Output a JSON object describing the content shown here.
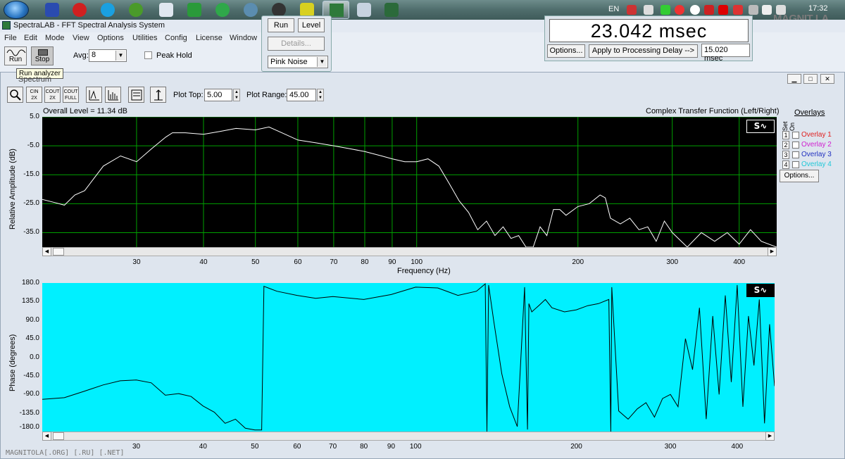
{
  "taskbar": {
    "language": "EN",
    "clock": "17:32",
    "tray_logo": "MAGNIT LA"
  },
  "window": {
    "title": "SpectraLAB - FFT Spectral Analysis System"
  },
  "menu": [
    "File",
    "Edit",
    "Mode",
    "View",
    "Options",
    "Utilities",
    "Config",
    "License",
    "Window"
  ],
  "toolbar": {
    "run_label": "Run",
    "stop_label": "Stop",
    "avg_label": "Avg:",
    "avg_value": "8",
    "peak_hold_label": "Peak Hold",
    "tooltip": "Run analyzer"
  },
  "generator": {
    "run_label": "Run",
    "level_label": "Level",
    "details_label": "Details...",
    "noise_value": "Pink Noise"
  },
  "delay": {
    "display": "23.042 msec",
    "options_label": "Options...",
    "apply_label": "Apply to Processing Delay -->",
    "value": "15.020 msec"
  },
  "spectrum": {
    "title": "Spectrum",
    "tools": [
      "zoom",
      "1/N 2X",
      "OUT 2X",
      "OUT FULL",
      "peak",
      "bars",
      "scroll",
      "cursor"
    ],
    "tool_labels": [
      "",
      "CIN 2X",
      "COUT 2X",
      "COUT FULL",
      "",
      "",
      "",
      ""
    ],
    "plot_top_label": "Plot Top:",
    "plot_top_value": "5.00",
    "plot_range_label": "Plot Range:",
    "plot_range_value": "45.00",
    "overall_level": "Overall Level = 11.34 dB",
    "transfer_title": "Complex Transfer Function (Left/Right)",
    "badge": "S∿",
    "overlays": {
      "title": "Overlays",
      "set_on": "Set On",
      "items": [
        {
          "num": "1",
          "label": "Overlay 1",
          "color": "#e02020"
        },
        {
          "num": "2",
          "label": "Overlay 2",
          "color": "#d020d0"
        },
        {
          "num": "3",
          "label": "Overlay 3",
          "color": "#2030c0"
        },
        {
          "num": "4",
          "label": "Overlay 4",
          "color": "#20c8d8"
        }
      ],
      "options_label": "Options..."
    }
  },
  "chart_data": [
    {
      "type": "line",
      "ylabel": "Relative Amplitude (dB)",
      "xlabel": "Frequency (Hz)",
      "xscale": "log",
      "xlim": [
        20,
        470
      ],
      "ylim": [
        -40,
        5
      ],
      "y_ticks": [
        "5.0",
        "-5.0",
        "-15.0",
        "-25.0",
        "-35.0"
      ],
      "x_ticks": [
        "30",
        "40",
        "50",
        "60",
        "70",
        "80",
        "90",
        "100",
        "200",
        "300",
        "400"
      ],
      "background": "#000000",
      "line_color": "#ffffff",
      "grid_color": "#00a000",
      "series": [
        {
          "x": [
            20,
            21,
            22,
            23,
            24,
            26,
            28,
            30,
            32,
            34,
            35,
            37,
            40,
            43,
            46,
            50,
            53,
            56,
            60,
            65,
            70,
            75,
            80,
            86,
            90,
            95,
            100,
            105,
            110,
            115,
            120,
            125,
            130,
            135,
            140,
            145,
            150,
            155,
            160,
            165,
            170,
            175,
            180,
            185,
            190,
            200,
            210,
            220,
            225,
            230,
            240,
            250,
            260,
            270,
            280,
            290,
            300,
            320,
            340,
            360,
            380,
            400,
            420,
            440,
            470
          ],
          "y": [
            -23.5,
            -24.5,
            -25.5,
            -22,
            -20.5,
            -12,
            -8.5,
            -10.5,
            -6,
            -2,
            -0.5,
            -0.5,
            -1,
            0,
            1,
            0.5,
            1.5,
            -0.5,
            -3,
            -4,
            -5,
            -6,
            -7,
            -8.5,
            -9.5,
            -10.5,
            -10.5,
            -9.5,
            -12,
            -18,
            -24,
            -28,
            -34,
            -31,
            -36,
            -33,
            -37,
            -36,
            -40,
            -40,
            -33,
            -36,
            -27,
            -27,
            -29,
            -26,
            -25,
            -22,
            -23,
            -30,
            -32,
            -30,
            -34,
            -33,
            -38,
            -31,
            -35,
            -40,
            -35,
            -38,
            -35,
            -39,
            -34,
            -38,
            -40
          ]
        }
      ]
    },
    {
      "type": "line",
      "ylabel": "Phase (degrees)",
      "xscale": "log",
      "xlim": [
        20,
        470
      ],
      "ylim": [
        -180,
        180
      ],
      "y_ticks": [
        "180.0",
        "135.0",
        "90.0",
        "45.0",
        "0.0",
        "-45.0",
        "-90.0",
        "-135.0",
        "-180.0"
      ],
      "x_ticks": [
        "30",
        "40",
        "50",
        "60",
        "70",
        "80",
        "90",
        "100",
        "200",
        "300",
        "400"
      ],
      "background": "#00f0ff",
      "line_color": "#000000",
      "series": [
        {
          "x": [
            20,
            22,
            24,
            26,
            28,
            30,
            32,
            34,
            36,
            38,
            40,
            42,
            44,
            46,
            48,
            50,
            51.5,
            52,
            55,
            60,
            65,
            70,
            80,
            90,
            100,
            110,
            120,
            130,
            135,
            136,
            137,
            140,
            145,
            150,
            155,
            160,
            162,
            163,
            165,
            170,
            175,
            180,
            190,
            200,
            210,
            220,
            230,
            232,
            233,
            240,
            250,
            260,
            270,
            280,
            290,
            300,
            310,
            320,
            330,
            340,
            350,
            360,
            370,
            380,
            390,
            400,
            410,
            420,
            430,
            440,
            450,
            460,
            470
          ],
          "y": [
            -102,
            -98,
            -82,
            -67,
            -57,
            -55,
            -62,
            -92,
            -88,
            -95,
            -118,
            -133,
            -160,
            -150,
            -172,
            -176,
            -176,
            172,
            160,
            150,
            143,
            147,
            140,
            152,
            170,
            168,
            150,
            160,
            178,
            -180,
            175,
            90,
            -40,
            -120,
            -168,
            170,
            -175,
            130,
            110,
            125,
            140,
            120,
            110,
            115,
            125,
            130,
            140,
            -180,
            170,
            -130,
            -150,
            -125,
            -110,
            -145,
            -100,
            -90,
            -120,
            45,
            -30,
            120,
            -150,
            100,
            -90,
            150,
            -60,
            175,
            -120,
            100,
            -20,
            140,
            -160,
            80,
            -70
          ]
        }
      ]
    }
  ],
  "watermark": "MAGNITOLA[.ORG] [.RU] [.NET]"
}
